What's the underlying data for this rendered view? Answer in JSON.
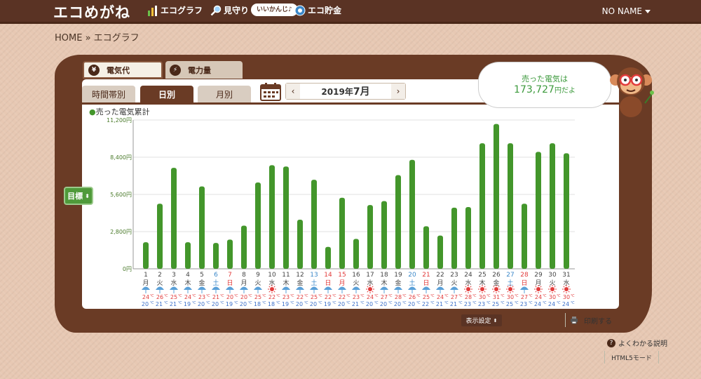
{
  "header": {
    "logo": "エコめがね",
    "nav_graph": "エコグラフ",
    "nav_watch": "見守り",
    "nav_watch_badge": "いいかんじ♪",
    "nav_savings": "エコ貯金",
    "user": "NO NAME"
  },
  "breadcrumb": "HOME » エコグラフ",
  "tabs": {
    "cost": "電気代",
    "power": "電力量"
  },
  "subtabs": {
    "hourly": "時間帯別",
    "daily": "日別",
    "monthly": "月別"
  },
  "month_nav": {
    "prev": "‹",
    "next": "›",
    "year": "2019年",
    "month": "7月"
  },
  "speech": {
    "line1": "売った電気は",
    "value": "173,727",
    "suffix": "円だよ"
  },
  "goal_button": "目標",
  "display_settings": "表示設定",
  "print": "印刷する",
  "help": "よくわかる説明",
  "html5_mode": "HTML5モード",
  "colors": {
    "bar": "#43962b",
    "sat": "#3b88c9",
    "sun": "#e23b3b",
    "brown": "#6a3b25"
  },
  "chart_data": {
    "type": "bar",
    "title": "売った電気累計",
    "ylim": [
      0,
      11200
    ],
    "yticks": [
      "0円",
      "2,800円",
      "5,600円",
      "8,400円",
      "11,200円"
    ],
    "days": [
      "1",
      "2",
      "3",
      "4",
      "5",
      "6",
      "7",
      "8",
      "9",
      "10",
      "11",
      "12",
      "13",
      "14",
      "15",
      "16",
      "17",
      "18",
      "19",
      "20",
      "21",
      "22",
      "23",
      "24",
      "25",
      "26",
      "27",
      "28",
      "29",
      "30",
      "31"
    ],
    "weekdays": [
      "月",
      "火",
      "水",
      "木",
      "金",
      "土",
      "日",
      "月",
      "火",
      "水",
      "木",
      "金",
      "土",
      "日",
      "月",
      "火",
      "水",
      "木",
      "金",
      "土",
      "日",
      "月",
      "火",
      "水",
      "木",
      "金",
      "土",
      "日",
      "月",
      "火",
      "水"
    ],
    "day_colors": [
      "n",
      "n",
      "n",
      "n",
      "n",
      "sat",
      "sun",
      "n",
      "n",
      "n",
      "n",
      "n",
      "sat",
      "sun",
      "sun",
      "n",
      "n",
      "n",
      "n",
      "sat",
      "sun",
      "n",
      "n",
      "n",
      "n",
      "n",
      "sat",
      "sun",
      "n",
      "n",
      "n"
    ],
    "values": [
      2000,
      4900,
      7600,
      2000,
      6200,
      1950,
      2200,
      3250,
      6500,
      7800,
      7700,
      3700,
      6700,
      1650,
      5350,
      2250,
      4800,
      5100,
      7050,
      8200,
      3200,
      2500,
      4600,
      4650,
      9450,
      10900,
      9450,
      4900,
      8800,
      9450,
      8700
    ],
    "weather": [
      "rain",
      "rain",
      "rain",
      "rain",
      "rain",
      "rain",
      "rain",
      "rain",
      "rain",
      "sun",
      "rain",
      "rain",
      "rain",
      "rain",
      "rain",
      "rain",
      "sun",
      "rain",
      "rain",
      "rain",
      "rain",
      "rain",
      "rain",
      "sun",
      "sun",
      "sun",
      "sun",
      "rain",
      "sun",
      "sun",
      "sun"
    ],
    "temp_high": [
      "24",
      "26",
      "25",
      "24",
      "23",
      "21",
      "20",
      "20",
      "25",
      "22",
      "23",
      "22",
      "25",
      "22",
      "22",
      "23",
      "24",
      "27",
      "28",
      "26",
      "25",
      "24",
      "27",
      "28",
      "30",
      "31",
      "30",
      "27",
      "24",
      "30",
      "30"
    ],
    "temp_low": [
      "20",
      "21",
      "21",
      "19",
      "20",
      "20",
      "19",
      "20",
      "18",
      "18",
      "19",
      "20",
      "20",
      "19",
      "20",
      "21",
      "20",
      "20",
      "20",
      "20",
      "22",
      "21",
      "21",
      "23",
      "23",
      "25",
      "25",
      "23",
      "24",
      "24",
      "24"
    ]
  }
}
